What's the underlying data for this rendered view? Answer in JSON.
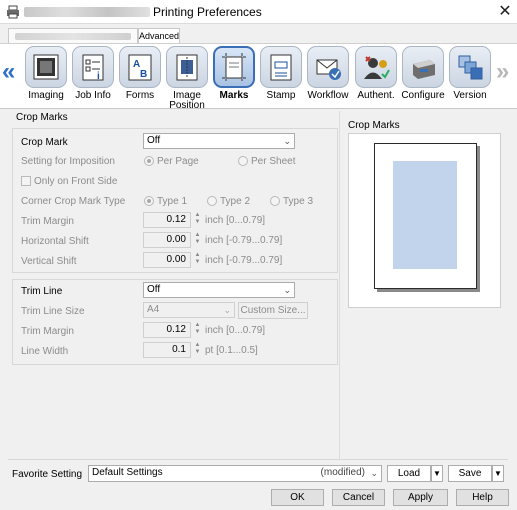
{
  "window": {
    "title": "Printing Preferences",
    "close_glyph": "✕"
  },
  "tabs": [
    {
      "label": ""
    },
    {
      "label": "Advanced"
    }
  ],
  "categories": [
    {
      "label": "Imaging",
      "icon": "imaging-icon"
    },
    {
      "label": "Job Info",
      "icon": "job-info-icon"
    },
    {
      "label": "Forms",
      "icon": "forms-icon"
    },
    {
      "label": "Image Position",
      "label1": "Image",
      "label2": "Position",
      "icon": "image-position-icon"
    },
    {
      "label": "Marks",
      "icon": "marks-icon",
      "selected": true
    },
    {
      "label": "Stamp",
      "icon": "stamp-icon"
    },
    {
      "label": "Workflow",
      "icon": "workflow-icon"
    },
    {
      "label": "Authent.",
      "icon": "authentication-icon"
    },
    {
      "label": "Configure",
      "icon": "configure-icon"
    },
    {
      "label": "Version",
      "icon": "version-icon"
    }
  ],
  "nav": {
    "left": "«",
    "right": "»"
  },
  "crop_marks": {
    "group_title": "Crop Marks",
    "crop_mark_label": "Crop Mark",
    "crop_mark_value": "Off",
    "imposition_label": "Setting for Imposition",
    "per_page": "Per Page",
    "per_sheet": "Per Sheet",
    "front_side_only": "Only on Front Side",
    "corner_type_label": "Corner Crop Mark Type",
    "type1": "Type 1",
    "type2": "Type 2",
    "type3": "Type 3",
    "trim_margin_label": "Trim Margin",
    "trim_margin_value": "0.12",
    "trim_margin_unit": "inch [0...0.79]",
    "hshift_label": "Horizontal Shift",
    "hshift_value": "0.00",
    "hshift_unit": "inch [-0.79...0.79]",
    "vshift_label": "Vertical Shift",
    "vshift_value": "0.00",
    "vshift_unit": "inch [-0.79...0.79]"
  },
  "trim_line": {
    "label": "Trim Line",
    "value": "Off",
    "size_label": "Trim Line Size",
    "size_value": "A4",
    "custom_size": "Custom Size...",
    "margin_label": "Trim Margin",
    "margin_value": "0.12",
    "margin_unit": "inch [0...0.79]",
    "width_label": "Line Width",
    "width_value": "0.1",
    "width_unit": "pt [0.1...0.5]"
  },
  "preview": {
    "title": "Crop Marks"
  },
  "favorite": {
    "label": "Favorite Setting",
    "value": "Default Settings",
    "modified": "(modified)",
    "load": "Load",
    "save": "Save"
  },
  "buttons": {
    "ok": "OK",
    "cancel": "Cancel",
    "apply": "Apply",
    "help": "Help"
  },
  "colors": {
    "accent": "#3b6fb5",
    "preview_fill": "#c2d4ec"
  }
}
